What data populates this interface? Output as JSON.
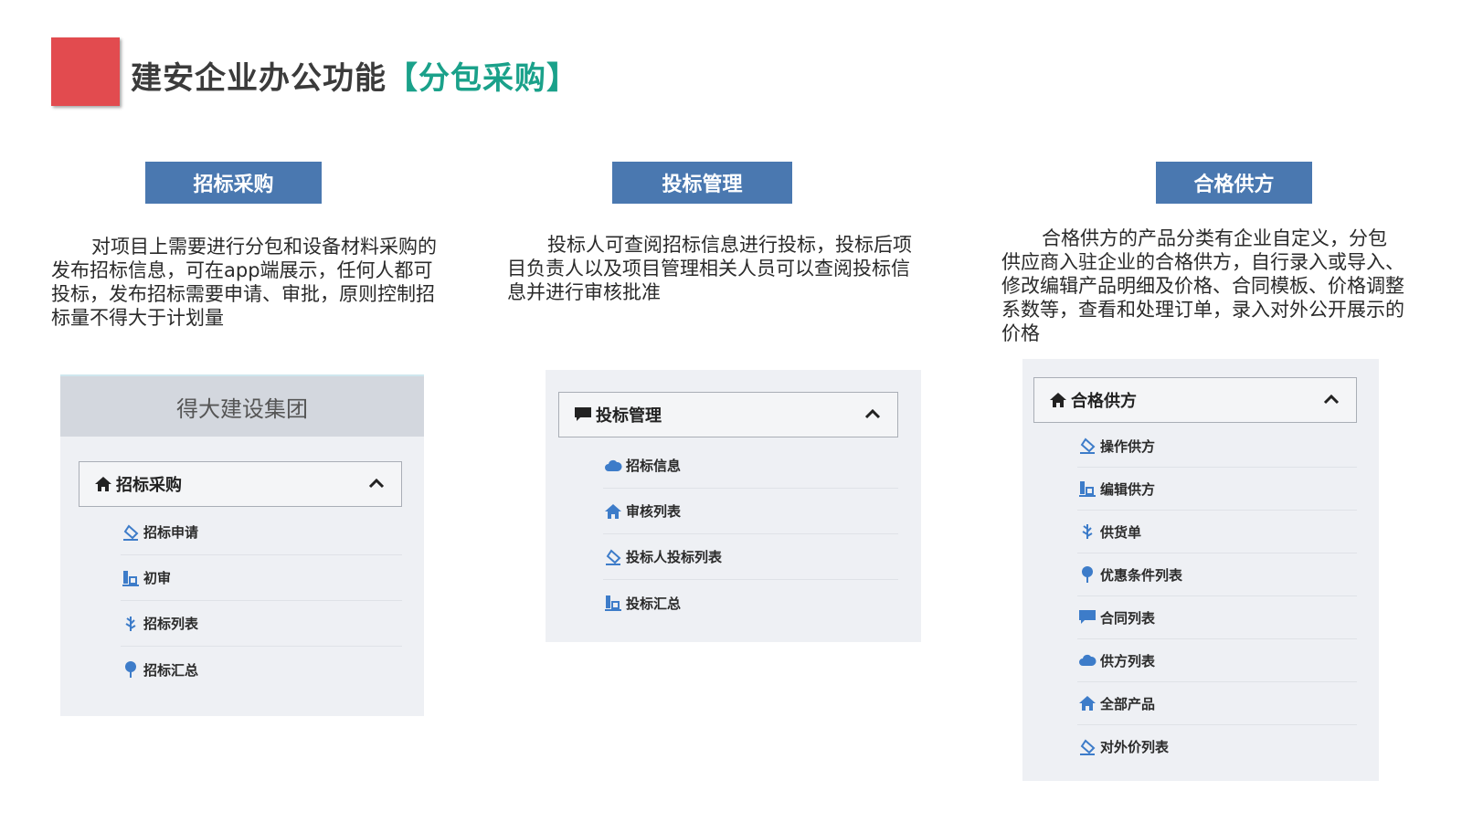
{
  "header": {
    "title_main": "建安企业办公功能",
    "title_highlight": "【分包采购】",
    "accent_color": "#e24b4f",
    "highlight_color": "#1aa18a"
  },
  "columns": [
    {
      "button": "招标采购",
      "description": "对项目上需要进行分包和设备材料采购的发布招标信息，可在app端展示，任何人都可投标，发布招标需要申请、审批，原则控制招标量不得大于计划量",
      "panel_title": "得大建设集团",
      "menu_header": {
        "label": "招标采购",
        "icon": "home-icon"
      },
      "items": [
        {
          "label": "招标申请",
          "icon": "eraser-icon"
        },
        {
          "label": "初审",
          "icon": "chart-icon"
        },
        {
          "label": "招标列表",
          "icon": "leaf-icon"
        },
        {
          "label": "招标汇总",
          "icon": "tree-icon"
        }
      ]
    },
    {
      "button": "投标管理",
      "description": "投标人可查阅招标信息进行投标，投标后项目负责人以及项目管理相关人员可以查阅投标信息并进行审核批准",
      "menu_header": {
        "label": "投标管理",
        "icon": "comment-icon"
      },
      "items": [
        {
          "label": "招标信息",
          "icon": "cloud-icon"
        },
        {
          "label": "审核列表",
          "icon": "home-icon"
        },
        {
          "label": "投标人投标列表",
          "icon": "eraser-icon"
        },
        {
          "label": "投标汇总",
          "icon": "chart-icon"
        }
      ]
    },
    {
      "button": "合格供方",
      "description": "合格供方的产品分类有企业自定义，分包供应商入驻企业的合格供方，自行录入或导入、修改编辑产品明细及价格、合同模板、价格调整系数等，查看和处理订单，录入对外公开展示的价格",
      "menu_header": {
        "label": "合格供方",
        "icon": "home-icon"
      },
      "items": [
        {
          "label": "操作供方",
          "icon": "eraser-icon"
        },
        {
          "label": "编辑供方",
          "icon": "chart-icon"
        },
        {
          "label": "供货单",
          "icon": "leaf-icon"
        },
        {
          "label": "优惠条件列表",
          "icon": "tree-icon"
        },
        {
          "label": "合同列表",
          "icon": "comment-icon"
        },
        {
          "label": "供方列表",
          "icon": "cloud-icon"
        },
        {
          "label": "全部产品",
          "icon": "home-icon"
        },
        {
          "label": "对外价列表",
          "icon": "eraser-icon"
        }
      ]
    }
  ],
  "colors": {
    "button_bg": "#4a78b0",
    "icon_blue": "#3d7cc9",
    "panel_bg": "#eef0f4"
  }
}
